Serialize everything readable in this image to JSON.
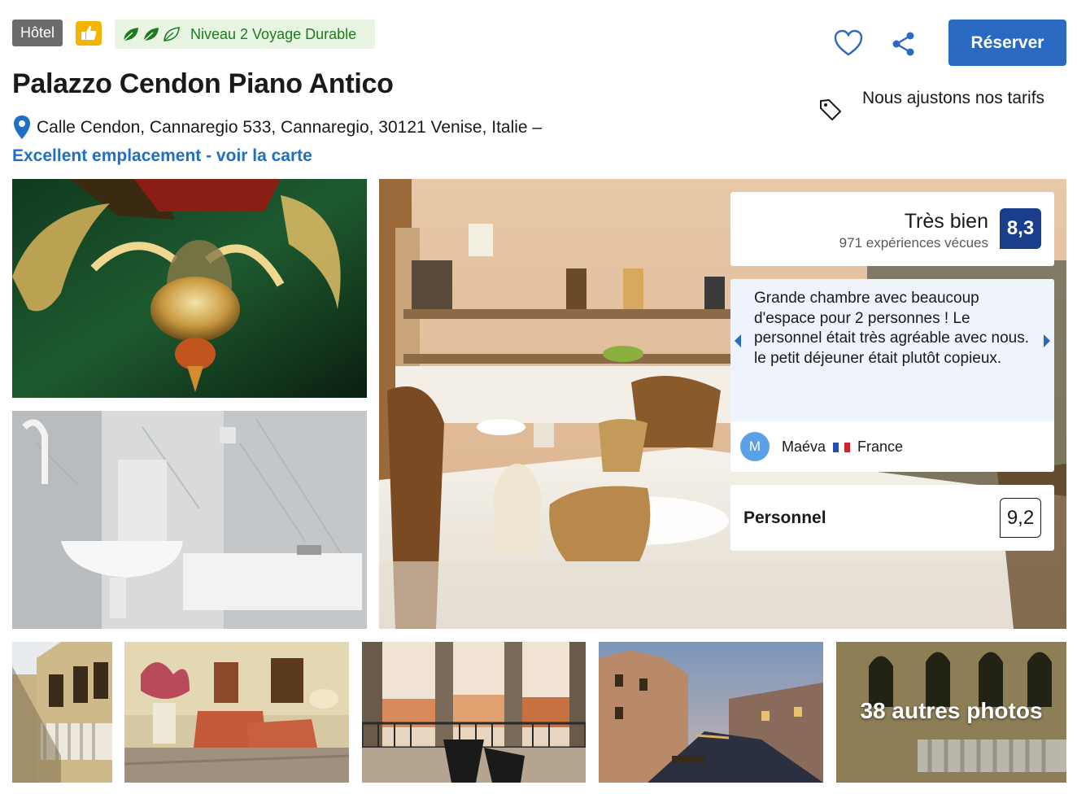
{
  "header": {
    "property_type": "Hôtel",
    "sustainability_label": "Niveau 2 Voyage Durable",
    "title": "Palazzo Cendon Piano Antico",
    "address": "Calle Cendon, Cannaregio 533, Cannaregio, 30121 Venise, Italie –",
    "map_link": "Excellent emplacement - voir la carte"
  },
  "actions": {
    "reserve_label": "Réserver",
    "price_note": "Nous ajustons nos tarifs"
  },
  "review": {
    "rating_word": "Très bien",
    "rating_count": "971 expériences vécues",
    "score": "8,3",
    "quote": "Grande chambre avec beaucoup d'espace pour 2 personnes ! Le personnel était très agréable avec nous. le petit déjeuner était plutôt copieux.",
    "reviewer_initial": "M",
    "reviewer_name": "Maéva",
    "reviewer_country": "France"
  },
  "category_score": {
    "label": "Personnel",
    "score": "9,2"
  },
  "gallery": {
    "more_photos_label": "38 autres photos"
  },
  "colors": {
    "brand_blue": "#2a6ac2",
    "score_navy": "#1a3d8c",
    "link_blue": "#1f6fc6",
    "sustainability_green": "#1f7a1f"
  }
}
